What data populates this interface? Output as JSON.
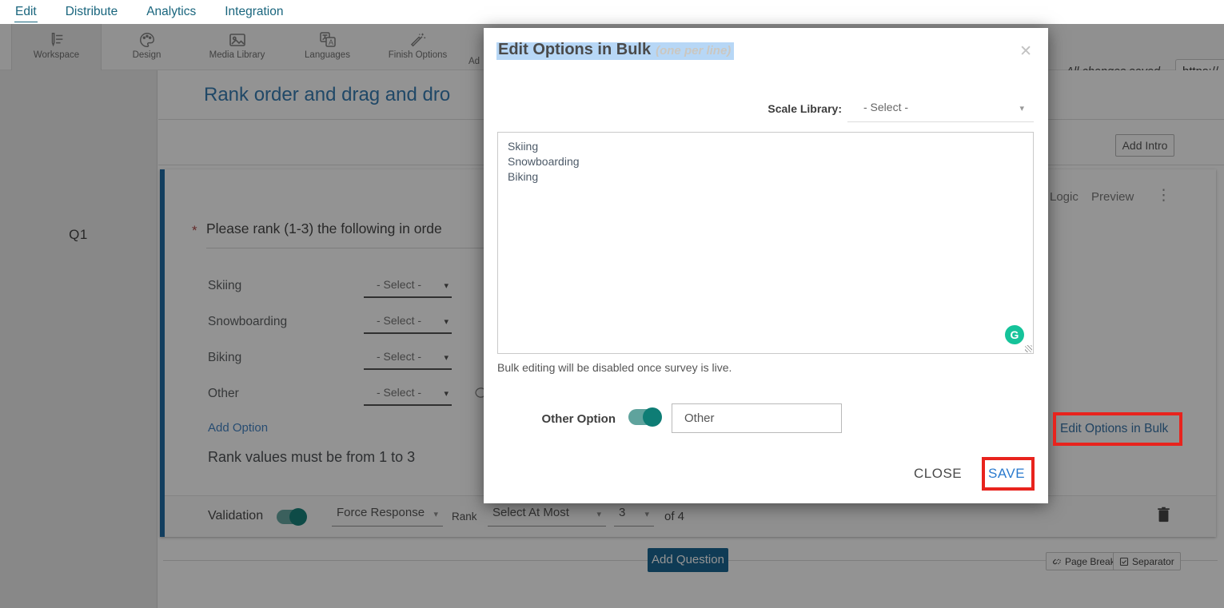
{
  "nav": {
    "items": [
      {
        "label": "Edit",
        "active": true
      },
      {
        "label": "Distribute",
        "active": false
      },
      {
        "label": "Analytics",
        "active": false
      },
      {
        "label": "Integration",
        "active": false
      }
    ]
  },
  "toolbar": {
    "tabs": [
      {
        "label": "Workspace",
        "icon": "workspace-icon",
        "active": true
      },
      {
        "label": "Design",
        "icon": "design-icon",
        "active": false
      },
      {
        "label": "Media Library",
        "icon": "media-library-icon",
        "active": false
      },
      {
        "label": "Languages",
        "icon": "languages-icon",
        "active": false
      },
      {
        "label": "Finish Options",
        "icon": "finish-options-icon",
        "active": false
      }
    ],
    "partial_tab_label": "Ad",
    "saved_status": "All changes saved",
    "url_value": "https://"
  },
  "sidebar": {
    "question_number": "Q1"
  },
  "content": {
    "survey_title": "Rank order and drag and dro",
    "add_intro_label": "Add Intro",
    "question": {
      "required_marker": "*",
      "text": "Please rank (1-3) the following in orde",
      "logic_label": "Logic",
      "preview_label": "Preview",
      "options": [
        {
          "label": "Skiing",
          "value": "- Select -"
        },
        {
          "label": "Snowboarding",
          "value": "- Select -"
        },
        {
          "label": "Biking",
          "value": "- Select -"
        },
        {
          "label": "Other",
          "value": "- Select -"
        }
      ],
      "add_option_label": "Add Option",
      "rank_note": "Rank values must be from 1 to 3",
      "edit_bulk_label": "Edit Options in Bulk",
      "validation": {
        "label": "Validation",
        "force_response": "Force Response",
        "rank_label": "Rank",
        "select_mode": "Select At Most",
        "count": "3",
        "of_label": "of 4"
      }
    },
    "add_question_label": "Add Question",
    "page_break_label": "Page Break",
    "separator_label": "Separator"
  },
  "modal": {
    "title": "Edit Options in Bulk",
    "subtitle": "(one per line)",
    "scale_library_label": "Scale Library:",
    "scale_library_value": "- Select -",
    "options_text": "Skiing\nSnowboarding\nBiking",
    "note": "Bulk editing will be disabled once survey is live.",
    "other_option_label": "Other Option",
    "other_value": "Other",
    "close_label": "CLOSE",
    "save_label": "SAVE"
  },
  "icons": {
    "chevron_down": "▾",
    "close": "✕",
    "kebab": "⋮",
    "grammarly": "G"
  },
  "colors": {
    "nav_teal": "#19657d",
    "title_blue": "#2e77b0",
    "link_blue": "#2e6da4",
    "button_blue": "#10608e",
    "question_accent_blue": "#1565a0",
    "toggle_teal": "#0e7d75",
    "toggle_track_teal": "#5fa39d",
    "annotation_red": "#e8231d",
    "grammarly_green": "#15c39a",
    "selection_highlight": "#b7d7f6"
  }
}
